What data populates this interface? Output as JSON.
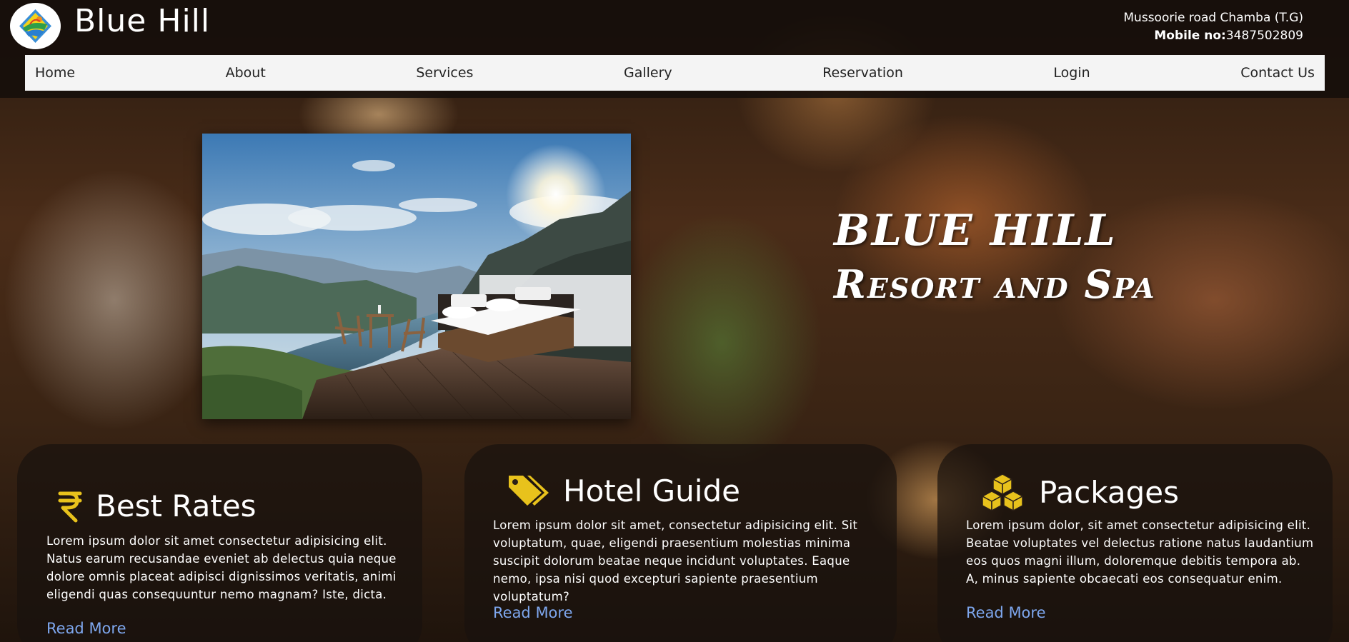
{
  "header": {
    "brand": "Blue Hill",
    "address": "Mussoorie road Chamba (T.G)",
    "mobile_label": "Mobile no:",
    "mobile_number": "3487502809"
  },
  "nav": {
    "items": [
      "Home",
      "About",
      "Services",
      "Gallery",
      "Reservation",
      "Login",
      "Contact Us"
    ]
  },
  "hero": {
    "title_line1": "BLUE HILL",
    "title_line2": "Resort and Spa"
  },
  "cards": [
    {
      "icon": "rupee-icon",
      "title": "Best Rates",
      "body": "Lorem ipsum dolor sit amet consectetur adipisicing elit. Natus earum recusandae eveniet ab delectus quia neque dolore omnis placeat adipisci dignissimos veritatis, animi eligendi quas consequuntur nemo magnam? Iste, dicta.",
      "link": "Read More"
    },
    {
      "icon": "tags-icon",
      "title": "Hotel Guide",
      "body": "Lorem ipsum dolor sit amet, consectetur adipisicing elit. Sit voluptatum, quae, eligendi praesentium molestias minima suscipit dolorum beatae neque incidunt voluptates. Eaque nemo, ipsa nisi quod excepturi sapiente praesentium voluptatum?",
      "link": "Read More"
    },
    {
      "icon": "cubes-icon",
      "title": "Packages",
      "body": "Lorem ipsum dolor, sit amet consectetur adipisicing elit. Beatae voluptates vel delectus ratione natus laudantium eos quos magni illum, doloremque debitis tempora ab. A, minus sapiente obcaecati eos consequatur enim.",
      "link": "Read More"
    }
  ],
  "colors": {
    "accent_icon": "#e8c21c",
    "link": "#7ea7ee",
    "nav_bg": "#f4f4f4"
  }
}
